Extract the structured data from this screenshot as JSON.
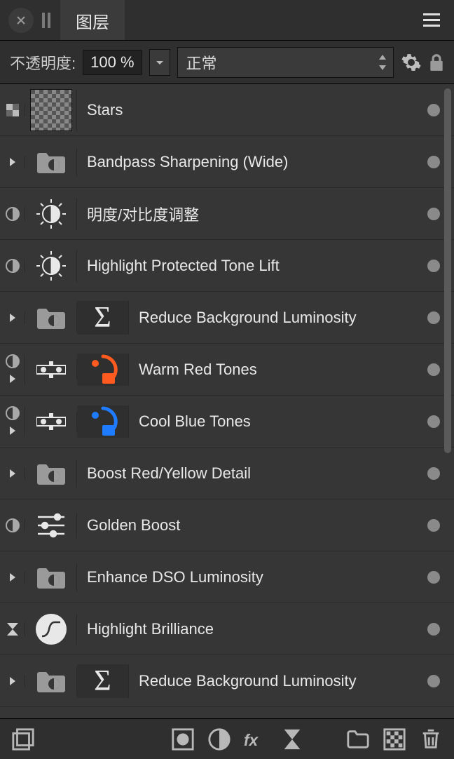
{
  "header": {
    "tab_title": "图层"
  },
  "options": {
    "opacity_label": "不透明度:",
    "opacity_value": "100 %",
    "blend_mode": "正常"
  },
  "layers": [
    {
      "name": "Stars",
      "toggle": "checker",
      "icon1": "thumb"
    },
    {
      "name": "Bandpass Sharpening (Wide)",
      "toggle": "chev",
      "icon1": "group"
    },
    {
      "name": "明度/对比度调整",
      "toggle": "half",
      "icon1": "brightcontrast"
    },
    {
      "name": "Highlight Protected Tone Lift",
      "toggle": "half",
      "icon1": "brightcontrast"
    },
    {
      "name": "Reduce Background Luminosity",
      "toggle": "chev",
      "icon1": "group",
      "icon2": "sigma"
    },
    {
      "name": "Warm Red Tones",
      "toggle": "half_chev",
      "icon1": "colormap",
      "icon2": "color_red"
    },
    {
      "name": "Cool Blue Tones",
      "toggle": "half_chev",
      "icon1": "colormap",
      "icon2": "color_blue"
    },
    {
      "name": "Boost Red/Yellow Detail",
      "toggle": "chev",
      "icon1": "group"
    },
    {
      "name": "Golden Boost",
      "toggle": "half",
      "icon1": "sliders"
    },
    {
      "name": "Enhance DSO Luminosity",
      "toggle": "chev",
      "icon1": "group"
    },
    {
      "name": "Highlight Brilliance",
      "toggle": "hourglass",
      "icon1": "wave"
    },
    {
      "name": "Reduce Background Luminosity",
      "toggle": "chev",
      "icon1": "group",
      "icon2": "sigma"
    }
  ]
}
